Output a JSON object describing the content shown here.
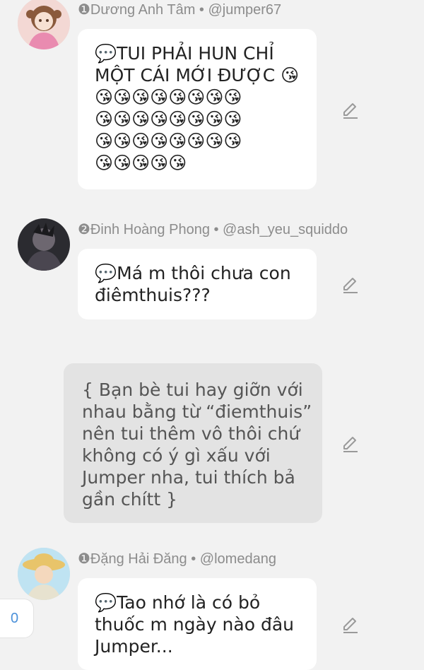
{
  "comments": [
    {
      "meta": "❶Dương Anh Tâm • @jumper67",
      "lines": [
        "💬TUI PHẢI HUN CHỈ",
        "MỘT CÁI MỚI ĐƯỢC 😘"
      ],
      "emoji_rows": [
        "😘😘😘😘😘😘😘😘",
        "😘😘😘😘😘😘😘😘",
        "😘😘😘😘😘😘😘😘",
        "😘😘😘😘😘"
      ],
      "edit_icon": "pencil-icon"
    },
    {
      "meta": "❷Đinh Hoàng Phong • @ash_yeu_squiddo",
      "lines": [
        "💬Má m thôi chưa con",
        "điêmthuis???"
      ],
      "edit_icon": "pencil-icon"
    },
    {
      "lines": [
        "{ Bạn bè tui hay giỡn với",
        "nhau bằng từ “điemthuis”",
        "nên tui thêm vô thôi chứ",
        "không có ý gì xấu với",
        "Jumper nha, tui thích bả",
        "gần chítt }"
      ],
      "edit_icon": "pencil-icon"
    },
    {
      "meta": "❶Đặng Hải Đăng • @lomedang",
      "lines": [
        "💬Tao nhớ là có bỏ",
        "thuốc m ngày nào đâu",
        "Jumper..."
      ],
      "edit_icon": "pencil-icon"
    }
  ],
  "counter": {
    "value": "0"
  },
  "colors": {
    "accent": "#4a90d9",
    "meta": "#8c8c8c",
    "background": "#f2f2f2",
    "note_bg": "#e3e3e3"
  }
}
